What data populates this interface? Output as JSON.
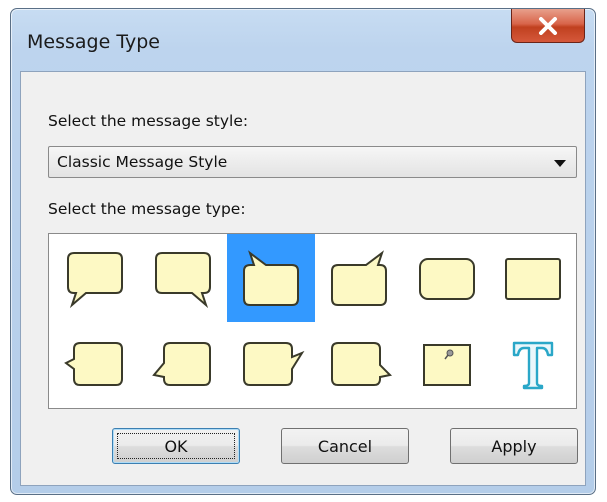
{
  "window": {
    "title": "Message Type"
  },
  "style_section": {
    "label": "Select the message style:",
    "selected": "Classic Message Style"
  },
  "type_section": {
    "label": "Select the message type:",
    "selected_index": 2,
    "types": [
      "callout-bottom-left-icon",
      "callout-bottom-right-icon",
      "callout-top-left-icon",
      "callout-top-right-icon",
      "rounded-rectangle-icon",
      "rectangle-icon",
      "callout-left-icon",
      "callout-left-lower-icon",
      "callout-right-icon",
      "callout-right-lower-icon",
      "note-pin-icon",
      "text-only-icon"
    ]
  },
  "buttons": {
    "ok": "OK",
    "cancel": "Cancel",
    "apply": "Apply"
  },
  "colors": {
    "balloon_fill": "#fdf9c4",
    "selection": "#3399ff",
    "text_icon": "#2aa7c8"
  }
}
